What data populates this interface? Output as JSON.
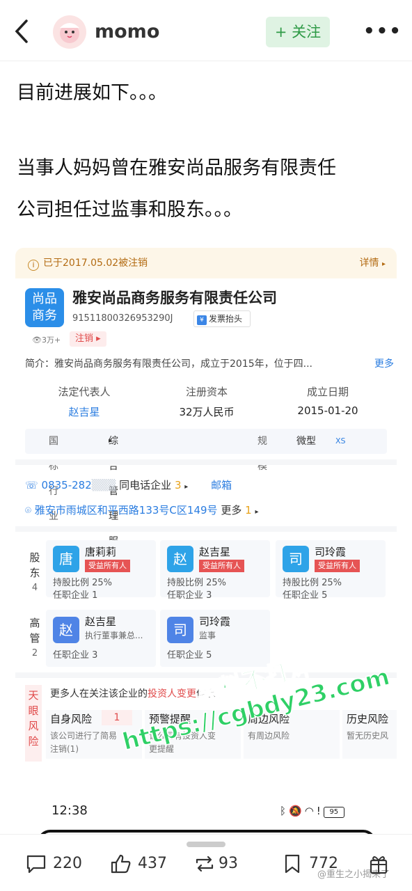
{
  "header": {
    "username": "momo",
    "follow_label": "+ 关注"
  },
  "post": {
    "line1": "目前进展如下。。。",
    "line2a": "当事人妈妈曾在雅安尚品服务有限责任",
    "line2b": "公司担任过监事和股东。。。"
  },
  "card": {
    "banner_text": "已于2017.05.02被注销",
    "banner_detail": "详情",
    "logo_line1": "尚品",
    "logo_line2": "商务",
    "company_name": "雅安尚品商务服务有限责任公司",
    "credit_code": "91511800326953290J",
    "invoice_label": "发票抬头",
    "invoice_icon": "¥",
    "views": "3万+",
    "status": "注销",
    "intro_label": "简介：",
    "intro_text": "雅安尚品商务服务有限责任公司，成立于2015年，位于四...",
    "intro_more": "更多",
    "legal_rep_label": "法定代表人",
    "legal_rep_value": "赵吉星",
    "capital_label": "注册资本",
    "capital_value": "32万人民币",
    "founded_label": "成立日期",
    "founded_value": "2015-01-20",
    "industry_label": "国标行业",
    "industry_value": "综合管理服务",
    "scale_label": "规模",
    "scale_value": "微型",
    "scale_tag": "XS",
    "phone": "0835-282",
    "phone_same": "同电话企业",
    "phone_count": "3",
    "email_label": "邮箱",
    "address": "雅安市雨城区和平西路133号C区149号",
    "address_more": "更多",
    "address_count": "1"
  },
  "shareholders": {
    "label_chars": [
      "股",
      "东"
    ],
    "count": "4",
    "items": [
      {
        "avatar": "唐",
        "name": "唐莉莉",
        "tag": "受益所有人",
        "ratio": "持股比例 25%",
        "jobs": "任职企业 1",
        "color": "#2ea3e8"
      },
      {
        "avatar": "赵",
        "name": "赵吉星",
        "tag": "受益所有人",
        "ratio": "持股比例 25%",
        "jobs": "任职企业 3",
        "color": "#2ea3e8"
      },
      {
        "avatar": "司",
        "name": "司玲霞",
        "tag": "受益所有人",
        "ratio": "持股比例 25%",
        "jobs": "任职企业 5",
        "color": "#2ea3e8"
      }
    ]
  },
  "executives": {
    "label_chars": [
      "高",
      "管"
    ],
    "count": "2",
    "items": [
      {
        "avatar": "赵",
        "name": "赵吉星",
        "role": "执行董事兼总...",
        "jobs": "任职企业 3",
        "color": "#4f84e6"
      },
      {
        "avatar": "司",
        "name": "司玲霞",
        "role": "监事",
        "jobs": "任职企业 5",
        "color": "#4f84e6"
      }
    ]
  },
  "risk": {
    "label_chars": [
      "天",
      "眼",
      "风",
      "险"
    ],
    "head_prefix": "更多人在关注该企业的",
    "head_red": "投资人变更",
    "head_suffix": "信息",
    "cols": [
      {
        "title": "自身风险",
        "count": "1",
        "desc1": "该公司进行了简易",
        "desc2": "注销(1)"
      },
      {
        "title": "预警提醒",
        "desc1": "该公司有投资人变",
        "desc2": "更提醒"
      },
      {
        "title": "周边风险",
        "desc1": "",
        "desc2": "有周边风险"
      },
      {
        "title": "历史风险",
        "desc1": "暂无历史风",
        "desc2": ""
      }
    ]
  },
  "watermark": {
    "line1": "黑料不打烊",
    "line2": "https://cgbdy23.com"
  },
  "statusbar": {
    "time": "12:38",
    "battery": "95"
  },
  "actions": {
    "comments": "220",
    "likes": "437",
    "reposts": "93",
    "favorites": "772",
    "credit": "@重生之小揭来了"
  },
  "icons": [
    "back-arrow-icon",
    "more-dots-icon",
    "info-icon",
    "chevron-right-icon",
    "phone-icon",
    "location-pin-icon",
    "comment-icon",
    "like-icon",
    "repost-icon",
    "bookmark-icon",
    "gift-icon"
  ]
}
